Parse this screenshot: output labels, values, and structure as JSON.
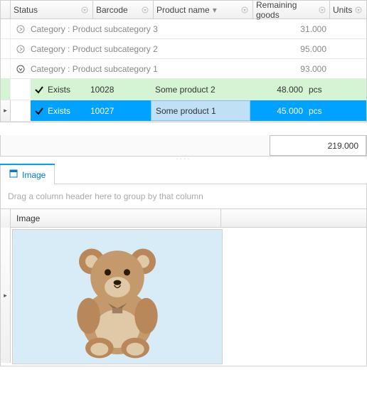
{
  "headers": {
    "status": "Status",
    "barcode": "Barcode",
    "product": "Product name",
    "remaining": "Remaining goods",
    "units": "Units"
  },
  "groups": [
    {
      "label": "Category : Product subcategory 3",
      "value": "31.000",
      "expanded": false
    },
    {
      "label": "Category : Product subcategory 2",
      "value": "95.000",
      "expanded": false
    },
    {
      "label": "Category : Product subcategory 1",
      "value": "93.000",
      "expanded": true
    }
  ],
  "rows": [
    {
      "status": "Exists",
      "barcode": "10028",
      "product": "Some product 2",
      "remaining": "48.000",
      "units": "pcs",
      "style": "green"
    },
    {
      "status": "Exists",
      "barcode": "10027",
      "product": "Some product 1",
      "remaining": "45.000",
      "units": "pcs",
      "style": "blue",
      "selected": true
    }
  ],
  "summary": {
    "total": "219.000"
  },
  "tab": {
    "label": "Image"
  },
  "groupHint": "Drag a column header here to group by that column",
  "imageGrid": {
    "header": "Image"
  }
}
